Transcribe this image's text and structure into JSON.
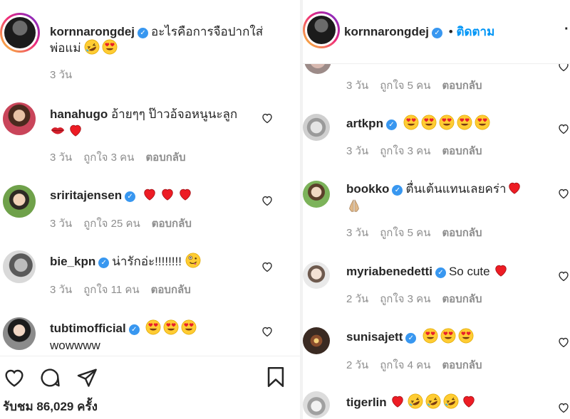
{
  "left": {
    "post": {
      "username": "kornnarongdej",
      "caption_line1": "อะไรคือการจือปากใส่",
      "caption_line2": "พ่อแม่",
      "time": "3 วัน"
    },
    "comments": [
      {
        "username": "hanahugo",
        "text": "อ้ายๆๆ ป๊าวอ้จอหนูนะลูก",
        "verified": false,
        "time": "3 วัน",
        "likes": "ถูกใจ 3 คน",
        "reply": "ตอบกลับ",
        "second_line": true
      },
      {
        "username": "sriritajensen",
        "text": "",
        "verified": true,
        "time": "3 วัน",
        "likes": "ถูกใจ 25 คน",
        "reply": "ตอบกลับ"
      },
      {
        "username": "bie_kpn",
        "text": "น่ารักอ่ะ!!!!!!!!",
        "verified": true,
        "time": "3 วัน",
        "likes": "ถูกใจ 11 คน",
        "reply": "ตอบกลับ"
      },
      {
        "username": "tubtimofficial",
        "text": "wowwww",
        "verified": true
      }
    ],
    "views": "รับชม 86,029 ครั้ง"
  },
  "right": {
    "header": {
      "username": "kornnarongdej",
      "separator": "•",
      "follow": "ติดตาม"
    },
    "top_meta": {
      "time": "3 วัน",
      "likes": "ถูกใจ 5 คน",
      "reply": "ตอบกลับ"
    },
    "comments": [
      {
        "username": "artkpn",
        "text": "",
        "verified": true,
        "time": "3 วัน",
        "likes": "ถูกใจ 3 คน",
        "reply": "ตอบกลับ"
      },
      {
        "username": "bookko",
        "text": "ตื่นเต้นแทนเลยคร่า",
        "verified": true,
        "time": "3 วัน",
        "likes": "ถูกใจ 5 คน",
        "reply": "ตอบกลับ"
      },
      {
        "username": "myriabenedetti",
        "text": "So cute",
        "verified": true,
        "time": "2 วัน",
        "likes": "ถูกใจ 3 คน",
        "reply": "ตอบกลับ"
      },
      {
        "username": "sunisajett",
        "text": "",
        "verified": true,
        "time": "2 วัน",
        "likes": "ถูกใจ 4 คน",
        "reply": "ตอบกลับ"
      },
      {
        "username": "tigerlin",
        "text": "",
        "verified": false
      }
    ]
  },
  "icons": {
    "verified": "verified-badge-icon",
    "heart_emoji": "red-heart-emoji",
    "heart_eyes": "heart-eyes-emoji",
    "laugh": "rolling-laughing-emoji",
    "kiss": "lips-emoji",
    "wink": "zany-face-emoji",
    "pray": "folded-hands-emoji"
  },
  "colors": {
    "link_blue": "#0095f6",
    "verified_blue": "#3897f0",
    "meta_gray": "#8e8e8e",
    "heart_red": "#ed1c24"
  }
}
